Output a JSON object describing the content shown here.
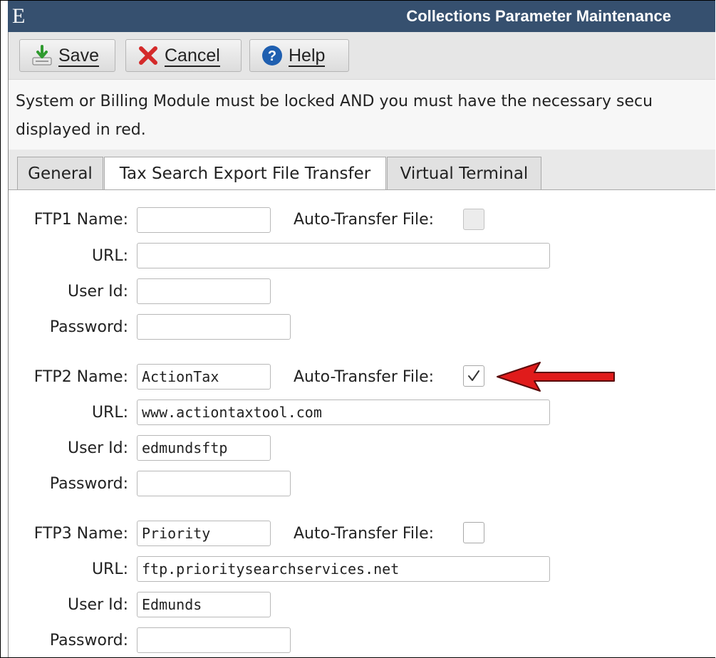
{
  "window": {
    "logo": "E",
    "title": "Collections Parameter Maintenance"
  },
  "toolbar": {
    "save_label": "Save",
    "cancel_label": "Cancel",
    "help_label": "Help"
  },
  "message": {
    "line1": "System or Billing Module must be locked AND you must have the necessary secu",
    "line2": "displayed in red."
  },
  "tabs": [
    {
      "label": "General"
    },
    {
      "label": "Tax Search Export File Transfer"
    },
    {
      "label": "Virtual Terminal"
    }
  ],
  "ftp": [
    {
      "name_label": "FTP1 Name:",
      "name": "",
      "auto_label": "Auto-Transfer File:",
      "auto_checked": false,
      "auto_enabled": false,
      "url_label": "URL:",
      "url": "",
      "user_label": "User Id:",
      "user": "",
      "pass_label": "Password:",
      "password": ""
    },
    {
      "name_label": "FTP2 Name:",
      "name": "ActionTax",
      "auto_label": "Auto-Transfer File:",
      "auto_checked": true,
      "auto_enabled": true,
      "url_label": "URL:",
      "url": "www.actiontaxtool.com",
      "user_label": "User Id:",
      "user": "edmundsftp",
      "pass_label": "Password:",
      "password": ""
    },
    {
      "name_label": "FTP3 Name:",
      "name": "Priority",
      "auto_label": "Auto-Transfer File:",
      "auto_checked": false,
      "auto_enabled": true,
      "url_label": "URL:",
      "url": "ftp.prioritysearchservices.net",
      "user_label": "User Id:",
      "user": "Edmunds",
      "pass_label": "Password:",
      "password": ""
    }
  ],
  "colors": {
    "titlebar": "#36506f",
    "annotation_arrow": "#e01b1b"
  },
  "icons": {
    "save": "save-icon",
    "cancel": "cancel-x-icon",
    "help": "help-question-icon",
    "check": "checkmark-icon",
    "arrow": "red-arrow-icon"
  }
}
